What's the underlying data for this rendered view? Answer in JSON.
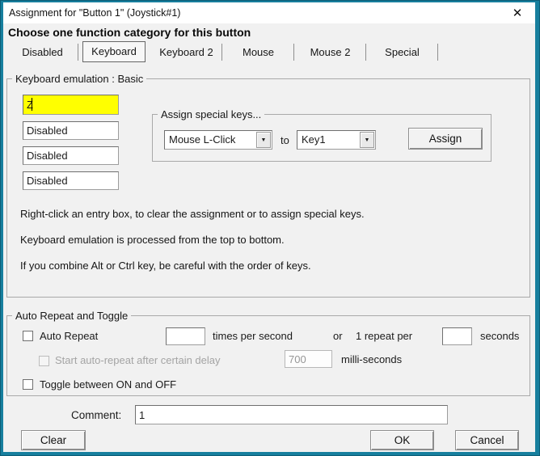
{
  "titlebar": {
    "title": "Assignment for \"Button 1\" (Joystick#1)",
    "close_glyph": "✕"
  },
  "heading": "Choose one function category for this button",
  "tabs": {
    "items": [
      "Disabled",
      "Keyboard",
      "Keyboard 2",
      "Mouse",
      "Mouse 2",
      "Special"
    ],
    "selected": "Keyboard"
  },
  "keyboard": {
    "group_label": "Keyboard emulation : Basic",
    "entry1": "Z",
    "entry2": "Disabled",
    "entry3": "Disabled",
    "entry4": "Disabled",
    "assign": {
      "group_label": "Assign special keys...",
      "source_value": "Mouse L-Click",
      "to_label": "to",
      "target_value": "Key1",
      "assign_button": "Assign",
      "arrow_glyph": "▼"
    },
    "info1": "Right-click an entry box, to clear the assignment or to assign special keys.",
    "info2": "Keyboard emulation is processed from the top to bottom.",
    "info3": "If you combine Alt or Ctrl key, be careful with the order of keys."
  },
  "auto_repeat": {
    "group_label": "Auto Repeat and Toggle",
    "auto_repeat_label": "Auto Repeat",
    "times_value": "",
    "times_label": "times per second",
    "or_label": "or",
    "repeat_per_label": "1 repeat per",
    "seconds_value": "",
    "seconds_label": "seconds",
    "delay_label": "Start auto-repeat after certain delay",
    "delay_value": "700",
    "delay_unit_label": "milli-seconds",
    "toggle_label": "Toggle between ON and OFF"
  },
  "footer": {
    "comment_label": "Comment:",
    "comment_value": "1",
    "clear_button": "Clear",
    "ok_button": "OK",
    "cancel_button": "Cancel"
  },
  "colors": {
    "frame_border": "#177f9e",
    "highlight_entry_bg": "#ffff00",
    "titlebar_bg": "#ffffff",
    "content_bg": "#f1f1f1"
  }
}
